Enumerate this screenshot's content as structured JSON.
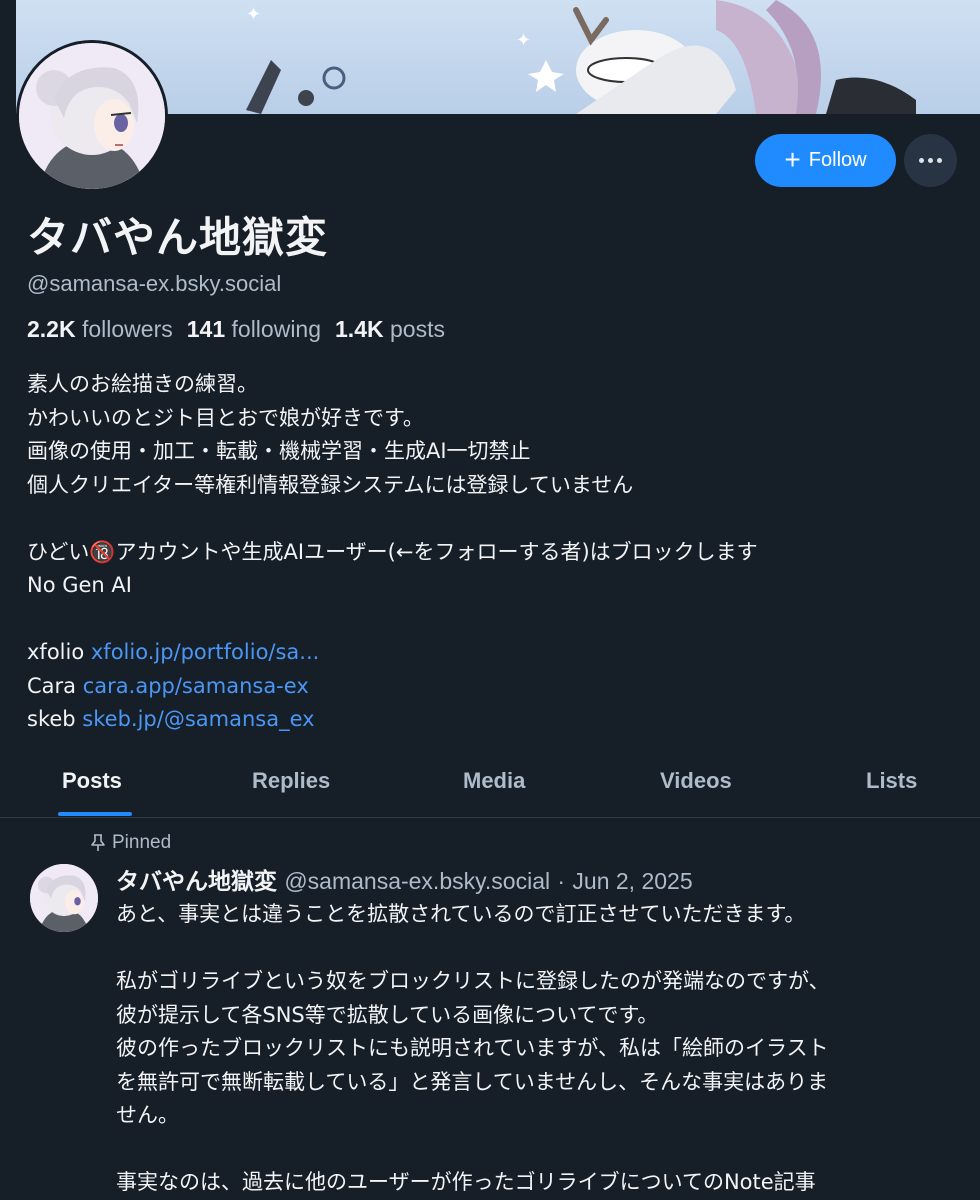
{
  "profile": {
    "display_name": "タバやん地獄変",
    "handle": "@samansa-ex.bsky.social",
    "follow_label": "Follow",
    "stats": {
      "followers_count": "2.2K",
      "followers_label": "followers",
      "following_count": "141",
      "following_label": "following",
      "posts_count": "1.4K",
      "posts_label": "posts"
    },
    "bio": {
      "line1": "素人のお絵描きの練習。",
      "line2": "かわいいのとジト目とおで娘が好きです。",
      "line3": "画像の使用・加工・転載・機械学習・生成AI一切禁止",
      "line4": "個人クリエイター等権利情報登録システムには登録していません",
      "line5": "ひどい🔞アカウントや生成AIユーザー(←をフォローする者)はブロックします",
      "line6": "No Gen AI",
      "links": [
        {
          "label": "xfolio",
          "url_text": "xfolio.jp/portfolio/sa..."
        },
        {
          "label": "Cara",
          "url_text": "cara.app/samansa-ex"
        },
        {
          "label": "skeb",
          "url_text": "skeb.jp/@samansa_ex"
        }
      ]
    }
  },
  "tabs": [
    "Posts",
    "Replies",
    "Media",
    "Videos",
    "Lists"
  ],
  "post": {
    "pinned_label": "Pinned",
    "author_name": "タバやん地獄変",
    "author_handle": "@samansa-ex.bsky.social",
    "separator": "·",
    "date": "Jun 2, 2025",
    "lines": [
      "あと、事実とは違うことを拡散されているので訂正させていただきます。",
      "",
      "私がゴリライブという奴をブロックリストに登録したのが発端なのですが、",
      "彼が提示して各SNS等で拡散している画像についてです。",
      "彼の作ったブロックリストにも説明されていますが、私は「絵師のイラスト",
      "を無許可で無断転載している」と発言していませんし、そんな事実はありま",
      "せん。",
      "",
      "事実なのは、過去に他のユーザーが作ったゴリライブについてのNote記事"
    ]
  },
  "colors": {
    "background": "#161e27",
    "accent": "#208bfe",
    "link": "#4a97f5",
    "muted_text": "#aebbc9"
  }
}
